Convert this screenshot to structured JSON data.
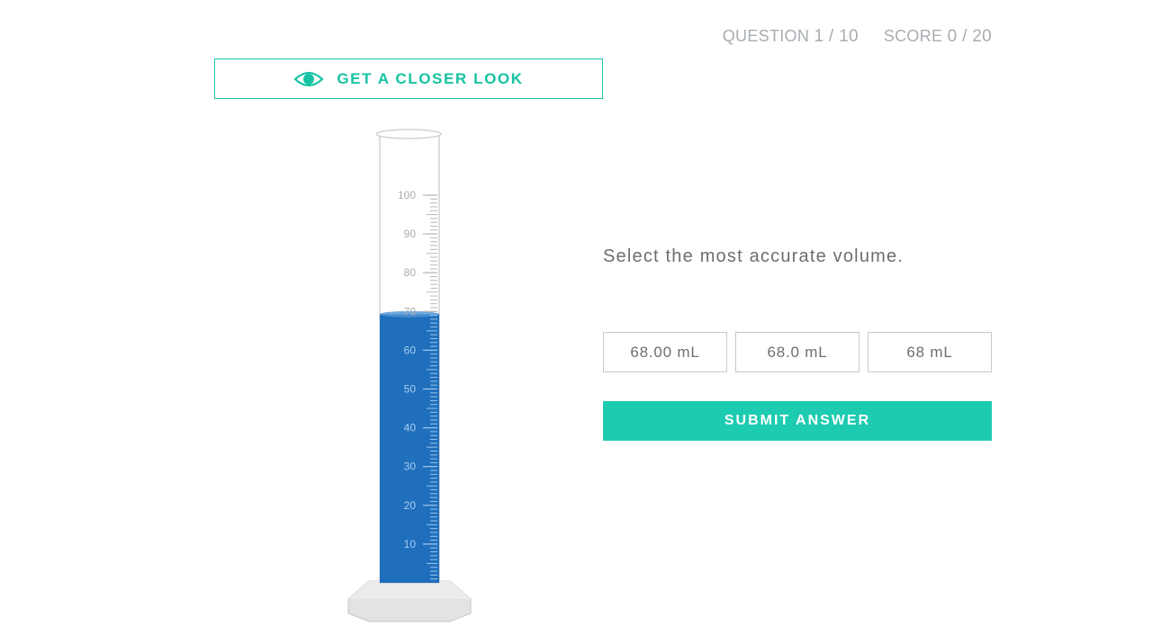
{
  "header": {
    "question_label": "QUESTION",
    "question_value": "1 / 10",
    "score_label": "SCORE",
    "score_value": "0 / 20"
  },
  "closer_look": {
    "label": "GET A CLOSER LOOK",
    "icon": "eye-icon"
  },
  "cylinder": {
    "tick_labels": [
      "100",
      "90",
      "80",
      "70",
      "60",
      "50",
      "40",
      "30",
      "20",
      "10"
    ],
    "liquid_level_ml": 69.3,
    "max_ml": 100,
    "liquid_color": "#1f6fbd"
  },
  "question": {
    "prompt": "Select the most accurate volume."
  },
  "choices": [
    "68.00 mL",
    "68.0 mL",
    "68 mL"
  ],
  "submit": {
    "label": "SUBMIT ANSWER"
  },
  "colors": {
    "accent": "#1dcbb0",
    "muted_text": "#a8adb1"
  }
}
